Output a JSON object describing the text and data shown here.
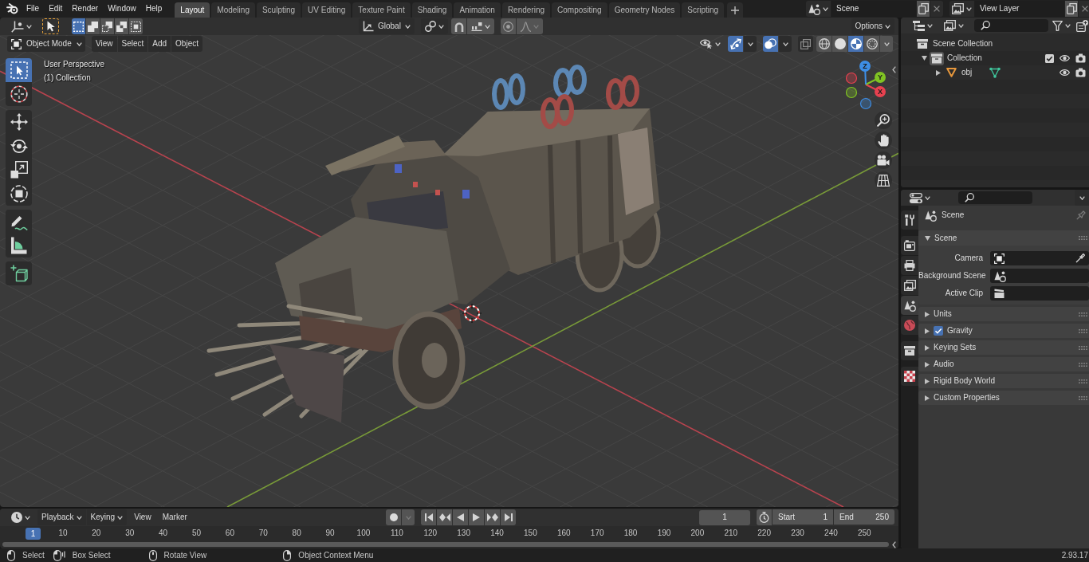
{
  "topbar": {
    "menus": [
      "File",
      "Edit",
      "Render",
      "Window",
      "Help"
    ],
    "workspaces": [
      {
        "label": "Layout",
        "selected": true
      },
      {
        "label": "Modeling",
        "selected": false
      },
      {
        "label": "Sculpting",
        "selected": false
      },
      {
        "label": "UV Editing",
        "selected": false
      },
      {
        "label": "Texture Paint",
        "selected": false
      },
      {
        "label": "Shading",
        "selected": false
      },
      {
        "label": "Animation",
        "selected": false
      },
      {
        "label": "Rendering",
        "selected": false
      },
      {
        "label": "Compositing",
        "selected": false
      },
      {
        "label": "Geometry Nodes",
        "selected": false
      },
      {
        "label": "Scripting",
        "selected": false
      }
    ],
    "scene": "Scene",
    "view_layer": "View Layer"
  },
  "viewport": {
    "select_modes": [
      {
        "selected": true
      },
      {
        "selected": false
      },
      {
        "selected": false
      },
      {
        "selected": false
      },
      {
        "selected": false
      }
    ],
    "orientation": "Global",
    "options": "Options",
    "mode": "Object Mode",
    "menus": [
      "View",
      "Select",
      "Add",
      "Object"
    ],
    "gizmos_on": true,
    "overlays_on": true,
    "xray_on": false,
    "shading_modes": [
      {
        "selected": false
      },
      {
        "selected": false
      },
      {
        "selected": true
      },
      {
        "selected": false
      }
    ],
    "info": [
      "User Perspective",
      "(1) Collection"
    ],
    "tools": [
      [
        {
          "selected": true
        },
        {
          "selected": false
        }
      ],
      [
        {
          "selected": false
        },
        {
          "selected": false
        },
        {
          "selected": false
        },
        {
          "selected": false
        }
      ],
      [
        {
          "selected": false
        },
        {
          "selected": false
        }
      ],
      [
        {
          "selected": false
        }
      ]
    ],
    "axes": [
      {
        "label": "X",
        "color": "#e8414f"
      },
      {
        "label": "Y",
        "color": "#80c323"
      },
      {
        "label": "Z",
        "color": "#3d8ee6"
      }
    ]
  },
  "outliner": {
    "tree": [
      {
        "label": "Scene Collection",
        "kind": "root",
        "children": [
          {
            "label": "Collection",
            "kind": "collection",
            "expanded": true,
            "active": true,
            "checked": true,
            "children": [
              {
                "label": "obj",
                "kind": "object",
                "expanded": false
              }
            ]
          }
        ]
      }
    ]
  },
  "properties": {
    "tabs": [
      [
        {
          "selected": false
        }
      ],
      [
        {
          "selected": false
        },
        {
          "selected": false
        },
        {
          "selected": false
        },
        {
          "selected": true
        },
        {
          "selected": false
        }
      ],
      [
        {
          "selected": false
        }
      ],
      [
        {
          "selected": false
        }
      ]
    ],
    "context": "Scene",
    "panels": [
      {
        "label": "Scene",
        "expanded": true,
        "fields": [
          {
            "label": "Camera"
          },
          {
            "label": "Background Scene"
          },
          {
            "label": "Active Clip"
          }
        ]
      },
      {
        "label": "Units",
        "expanded": false
      },
      {
        "label": "Gravity",
        "expanded": false,
        "checked": true
      },
      {
        "label": "Keying Sets",
        "expanded": false
      },
      {
        "label": "Audio",
        "expanded": false
      },
      {
        "label": "Rigid Body World",
        "expanded": false
      },
      {
        "label": "Custom Properties",
        "expanded": false
      }
    ]
  },
  "timeline": {
    "dropdowns": [
      "Playback",
      "Keying"
    ],
    "menus": [
      "View",
      "Marker"
    ],
    "current_frame": "1",
    "start": {
      "label": "Start",
      "value": "1"
    },
    "end": {
      "label": "End",
      "value": "250"
    },
    "playhead": "1",
    "ticks": [
      "10",
      "20",
      "30",
      "40",
      "50",
      "60",
      "70",
      "80",
      "90",
      "100",
      "110",
      "120",
      "130",
      "140",
      "150",
      "160",
      "170",
      "180",
      "190",
      "200",
      "210",
      "220",
      "230",
      "240",
      "250"
    ]
  },
  "status_bar": {
    "hints": [
      "Select",
      "Box Select",
      "Rotate View",
      "Object Context Menu"
    ],
    "version": "2.93.17"
  }
}
